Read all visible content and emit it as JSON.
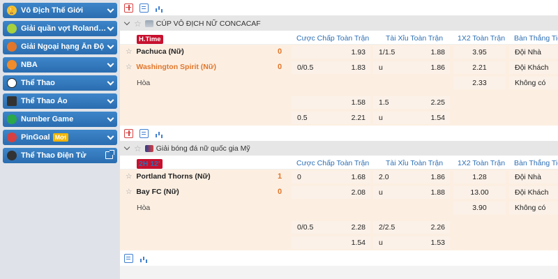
{
  "sidebar": {
    "items": [
      {
        "label": "Vô Địch Thế Giới",
        "icon": "trophy-icon",
        "color": "#f2c230"
      },
      {
        "label": "Giải quần vợt Roland-G...",
        "icon": "tennis-icon",
        "color": "#a7d13d"
      },
      {
        "label": "Giải Ngoại hạng Ấn Độ",
        "icon": "cricket-icon",
        "color": "#e2762b"
      },
      {
        "label": "NBA",
        "icon": "basketball-icon",
        "color": "#f08c2a"
      },
      {
        "label": "Thể Thao",
        "icon": "soccer-icon",
        "color": "#ffffff"
      },
      {
        "label": "Thể Thao Ảo",
        "icon": "virtual-sports-icon",
        "color": "#333333"
      },
      {
        "label": "Number Game",
        "icon": "number-ball-icon",
        "color": "#2aa84a"
      },
      {
        "label": "PinGoal",
        "badge": "Mới",
        "icon": "pingoal-icon",
        "color": "#d64040"
      },
      {
        "label": "Thể Thao Điện Tử",
        "icon": "headset-icon",
        "color": "#333333"
      }
    ]
  },
  "headers": {
    "handicap": "Cược Chấp Toàn Trận",
    "overunder": "Tài Xỉu Toàn Trận",
    "onextwo": "1X2 Toàn Trận",
    "winner": "Bàn Thắng Tiế"
  },
  "leagues": [
    {
      "name": "CÚP VÔ ĐỊCH NỮ CONCACAF",
      "status": "H.Time",
      "home": "Pachuca (Nữ)",
      "away": "Washington Spirit (Nữ)",
      "draw": "Hòa",
      "home_score": "0",
      "away_score": "0",
      "main_lines": [
        {
          "hdp": "",
          "hdp_odds": "1.93",
          "ou": "1/1.5",
          "ou_odds": "1.88",
          "x12": "3.95",
          "goal": "Đội Nhà"
        },
        {
          "hdp": "0/0.5",
          "hdp_odds": "1.83",
          "ou": "u",
          "ou_odds": "1.86",
          "x12": "2.21",
          "goal": "Đội Khách"
        },
        {
          "hdp": "",
          "hdp_odds": "",
          "ou": "",
          "ou_odds": "",
          "x12": "2.33",
          "goal": "Không có"
        }
      ],
      "alt_lines": [
        {
          "hdp": "",
          "hdp_odds": "1.58",
          "ou": "1.5",
          "ou_odds": "2.25"
        },
        {
          "hdp": "0.5",
          "hdp_odds": "2.21",
          "ou": "u",
          "ou_odds": "1.54"
        }
      ]
    },
    {
      "name": "Giải bóng đá nữ quốc gia Mỹ",
      "status": "2H 12'",
      "home": "Portland Thorns (Nữ)",
      "away": "Bay FC (Nữ)",
      "draw": "Hòa",
      "home_score": "1",
      "away_score": "0",
      "main_lines": [
        {
          "hdp": "0",
          "hdp_odds": "1.68",
          "ou": "2.0",
          "ou_odds": "1.86",
          "x12": "1.28",
          "goal": "Đội Nhà"
        },
        {
          "hdp": "",
          "hdp_odds": "2.08",
          "ou": "u",
          "ou_odds": "1.88",
          "x12": "13.00",
          "goal": "Đội Khách"
        },
        {
          "hdp": "",
          "hdp_odds": "",
          "ou": "",
          "ou_odds": "",
          "x12": "3.90",
          "goal": "Không có"
        }
      ],
      "alt_lines": [
        {
          "hdp": "0/0.5",
          "hdp_odds": "2.28",
          "ou": "2/2.5",
          "ou_odds": "2.26"
        },
        {
          "hdp": "",
          "hdp_odds": "1.54",
          "ou": "u",
          "ou_odds": "1.53"
        }
      ]
    }
  ]
}
